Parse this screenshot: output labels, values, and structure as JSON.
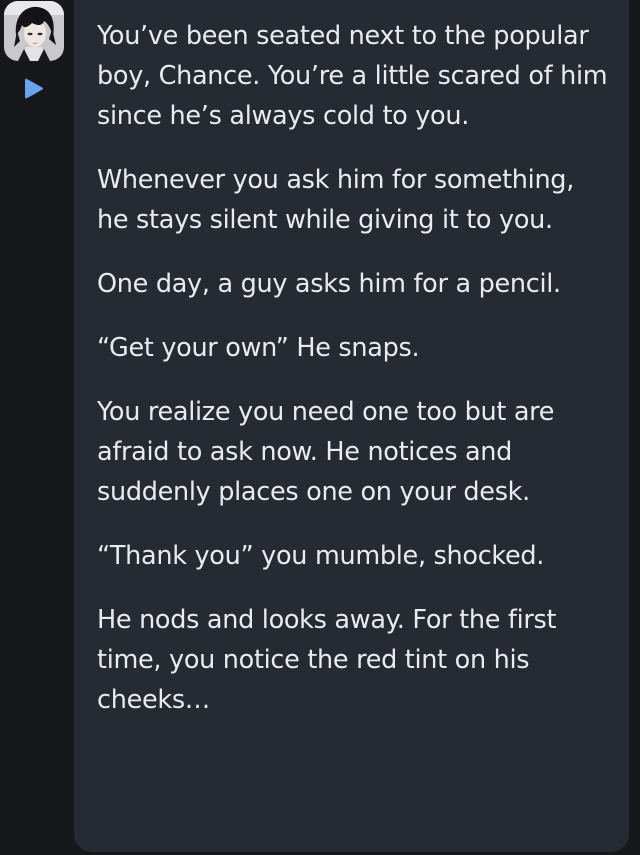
{
  "avatar": {
    "icon": "character-avatar-icon"
  },
  "controls": {
    "play_icon": "play-icon",
    "accent": "#6ba3ee"
  },
  "message": {
    "paragraphs": [
      "You’ve been seated next to the popular boy, Chance. You’re a little scared of him since he’s always cold to you.",
      "Whenever you ask him for something, he stays silent while giving it to you.",
      "One day, a guy asks him for a pencil.",
      "“Get your own” He snaps.",
      "You realize you need one too but are afraid to ask now. He notices and suddenly places one on your desk.",
      "“Thank you” you mumble, shocked.",
      "He nods and looks away. For the first time, you notice the red tint on his cheeks…"
    ]
  }
}
